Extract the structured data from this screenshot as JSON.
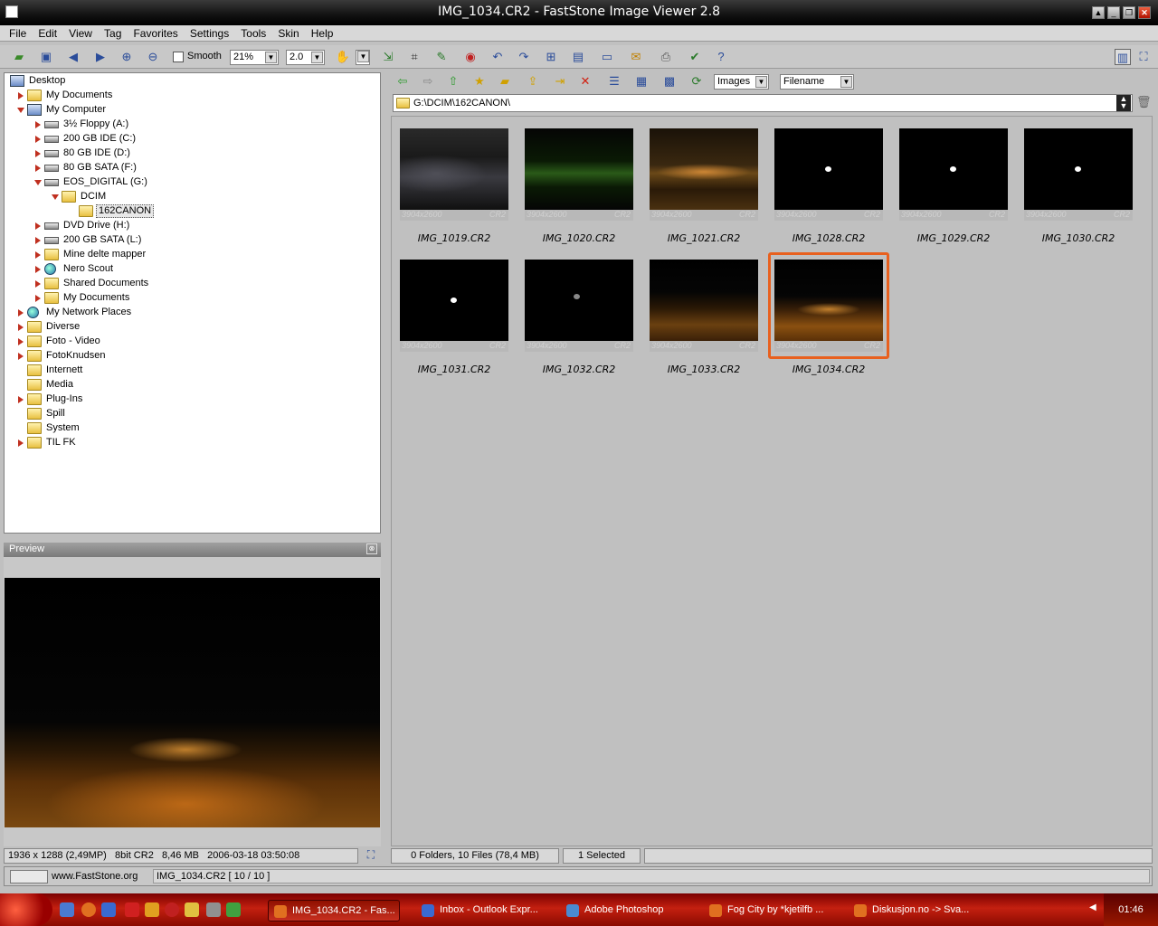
{
  "window": {
    "title": "IMG_1034.CR2  -  FastStone Image Viewer 2.8"
  },
  "menu": [
    "File",
    "Edit",
    "View",
    "Tag",
    "Favorites",
    "Settings",
    "Tools",
    "Skin",
    "Help"
  ],
  "toolbar": {
    "smooth_label": "Smooth",
    "zoom_value": "21%",
    "ratio_value": "2.0"
  },
  "tree": [
    {
      "label": "Desktop",
      "icon": "desktop-icon"
    },
    {
      "label": "My Documents",
      "icon": "folder-icon"
    },
    {
      "label": "My Computer",
      "icon": "computer-icon"
    },
    {
      "label": "3½ Floppy (A:)",
      "icon": "floppy-icon"
    },
    {
      "label": "200 GB IDE (C:)",
      "icon": "drive-icon"
    },
    {
      "label": "80 GB IDE (D:)",
      "icon": "drive-icon"
    },
    {
      "label": "80 GB SATA (F:)",
      "icon": "drive-icon"
    },
    {
      "label": "EOS_DIGITAL (G:)",
      "icon": "drive-icon"
    },
    {
      "label": "DCIM",
      "icon": "folder-icon"
    },
    {
      "label": "162CANON",
      "icon": "folder-icon"
    },
    {
      "label": "DVD Drive (H:)",
      "icon": "dvd-icon"
    },
    {
      "label": "200 GB SATA (L:)",
      "icon": "drive-icon"
    },
    {
      "label": "Mine delte mapper",
      "icon": "shared-folder-icon"
    },
    {
      "label": "Nero Scout",
      "icon": "globe-icon"
    },
    {
      "label": "Shared Documents",
      "icon": "folder-icon"
    },
    {
      "label": "My Documents",
      "icon": "folder-icon"
    },
    {
      "label": "My Network Places",
      "icon": "network-icon"
    },
    {
      "label": "Diverse",
      "icon": "folder-icon"
    },
    {
      "label": "Foto - Video",
      "icon": "folder-icon"
    },
    {
      "label": "FotoKnudsen",
      "icon": "folder-icon"
    },
    {
      "label": "Internett",
      "icon": "folder-icon"
    },
    {
      "label": "Media",
      "icon": "folder-icon"
    },
    {
      "label": "Plug-Ins",
      "icon": "folder-icon"
    },
    {
      "label": "Spill",
      "icon": "folder-icon"
    },
    {
      "label": "System",
      "icon": "folder-icon"
    },
    {
      "label": "TIL FK",
      "icon": "folder-icon"
    }
  ],
  "preview": {
    "header": "Preview",
    "status": "1936 x 1288 (2,49MP)   8bit CR2   8,46 MB   2006-03-18 03:50:08"
  },
  "browser": {
    "filter_value": "Images",
    "sort_value": "Filename",
    "path": "G:\\DCIM\\162CANON\\",
    "thumbs": [
      {
        "name": "IMG_1019.CR2",
        "dims": "3904x2600",
        "ext": "CR2",
        "kind": "dusk"
      },
      {
        "name": "IMG_1020.CR2",
        "dims": "3904x2600",
        "ext": "CR2",
        "kind": "green"
      },
      {
        "name": "IMG_1021.CR2",
        "dims": "3904x2600",
        "ext": "CR2",
        "kind": "fog"
      },
      {
        "name": "IMG_1028.CR2",
        "dims": "3904x2600",
        "ext": "CR2",
        "kind": "moon"
      },
      {
        "name": "IMG_1029.CR2",
        "dims": "3904x2600",
        "ext": "CR2",
        "kind": "moon"
      },
      {
        "name": "IMG_1030.CR2",
        "dims": "3904x2600",
        "ext": "CR2",
        "kind": "moon"
      },
      {
        "name": "IMG_1031.CR2",
        "dims": "3904x2600",
        "ext": "CR2",
        "kind": "moon"
      },
      {
        "name": "IMG_1032.CR2",
        "dims": "3904x2600",
        "ext": "CR2",
        "kind": "moon-dim"
      },
      {
        "name": "IMG_1033.CR2",
        "dims": "3904x2600",
        "ext": "CR2",
        "kind": "city"
      },
      {
        "name": "IMG_1034.CR2",
        "dims": "3904x2600",
        "ext": "CR2",
        "kind": "city-bright",
        "selected": true
      }
    ],
    "status_files": "0 Folders, 10 Files (78,4 MB)",
    "status_selected": "1 Selected"
  },
  "bottom": {
    "site": "www.FastStone.org",
    "filename": "IMG_1034.CR2 [ 10 / 10 ]"
  },
  "taskbar": {
    "tasks": [
      {
        "label": "IMG_1034.CR2 - Fas...",
        "active": true
      },
      {
        "label": "Inbox - Outlook Expr..."
      },
      {
        "label": "Adobe Photoshop"
      },
      {
        "label": "Fog City by *kjetilfb ..."
      },
      {
        "label": "Diskusjon.no -> Sva..."
      }
    ],
    "clock": "01:46"
  },
  "colors": {
    "selection": "#e8601e",
    "taskbar": "#c42010"
  }
}
